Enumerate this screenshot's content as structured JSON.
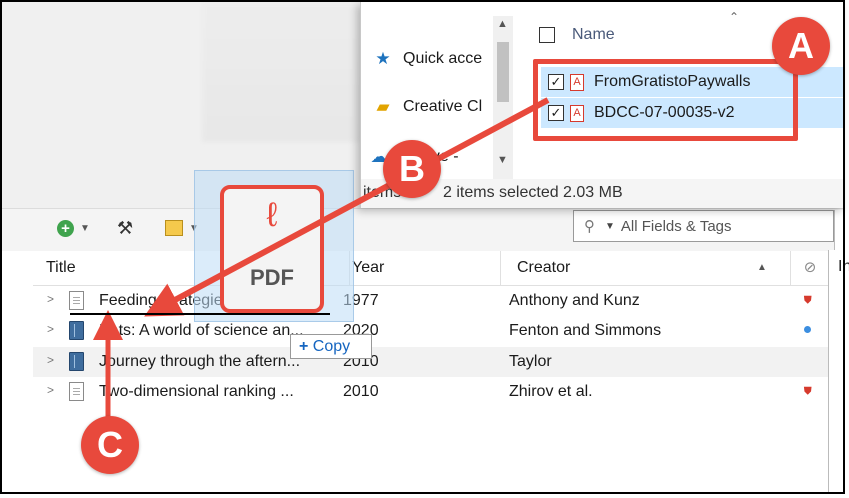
{
  "explorer": {
    "nav": [
      "Quick acce",
      "Creative Cl",
      "rive -"
    ],
    "column_name": "Name",
    "files": [
      "FromGratistoPaywalls",
      "BDCC-07-00035-v2"
    ],
    "status_label": "items",
    "status": "2 items selected  2.03 MB"
  },
  "toolbar": {
    "search_placeholder": "All Fields & Tags"
  },
  "table": {
    "headers": {
      "title": "Title",
      "year": "Year",
      "creator": "Creator"
    },
    "rows": [
      {
        "title": "Feeding strategies of the li...",
        "year": "1977",
        "creator": "Anthony and Kunz",
        "type": "doc",
        "attachment": "pdf"
      },
      {
        "title": "Bats: A world of science an...",
        "year": "2020",
        "creator": "Fenton and Simmons",
        "type": "book",
        "attachment": "dot"
      },
      {
        "title": "Journey through the aftern...",
        "year": "2010",
        "creator": "Taylor",
        "type": "book",
        "attachment": ""
      },
      {
        "title": "Two-dimensional ranking ...",
        "year": "2010",
        "creator": "Zhirov et al.",
        "type": "doc",
        "attachment": "pdf"
      }
    ]
  },
  "drag": {
    "pdf_label": "PDF",
    "copy_label": "Copy"
  },
  "annotations": {
    "a": "A",
    "b": "B",
    "c": "C"
  },
  "side_panel_letter": "In"
}
